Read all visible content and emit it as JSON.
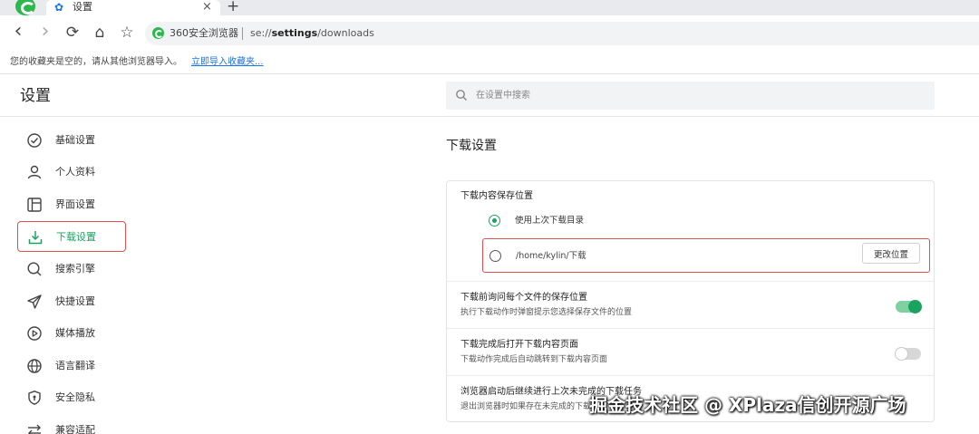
{
  "tab": {
    "title": "设置",
    "close": "×",
    "new_tab": "+"
  },
  "toolbar": {
    "back": "‹",
    "forward": "›",
    "reload": "⟳",
    "home": "⌂",
    "star": "☆",
    "site_label": "360安全浏览器",
    "url_scheme": "se://",
    "url_host": "settings",
    "url_path": "/downloads"
  },
  "bookmarks_bar": {
    "message": "您的收藏夹是空的，请从其他浏览器导入。",
    "import_link": "立即导入收藏夹..."
  },
  "header": {
    "title": "设置",
    "search_placeholder": "在设置中搜索"
  },
  "sidebar": {
    "items": [
      {
        "label": "基础设置",
        "icon": "check-circle-icon"
      },
      {
        "label": "个人资料",
        "icon": "person-icon"
      },
      {
        "label": "界面设置",
        "icon": "layout-icon"
      },
      {
        "label": "下载设置",
        "icon": "download-icon",
        "active": true
      },
      {
        "label": "搜索引擎",
        "icon": "search-icon"
      },
      {
        "label": "快捷设置",
        "icon": "send-icon"
      },
      {
        "label": "媒体播放",
        "icon": "play-circle-icon"
      },
      {
        "label": "语言翻译",
        "icon": "globe-icon"
      },
      {
        "label": "安全隐私",
        "icon": "shield-icon"
      },
      {
        "label": "兼容适配",
        "icon": "arrows-icon"
      }
    ]
  },
  "main": {
    "section_title": "下载设置",
    "save_location": {
      "title": "下载内容保存位置",
      "option_last": "使用上次下载目录",
      "option_path": "/home/kylin/下载",
      "change_button": "更改位置",
      "selected": "last"
    },
    "options": [
      {
        "title": "下载前询问每个文件的保存位置",
        "desc": "执行下载动作时弹窗提示您选择保存文件的位置",
        "enabled": true
      },
      {
        "title": "下载完成后打开下载内容页面",
        "desc": "下载动作完成后自动跳转到下载内容页面",
        "enabled": false
      },
      {
        "title": "浏览器启动后继续进行上次未完成的下载任务",
        "desc": "退出浏览器时如果存在未完成的下载任务"
      }
    ]
  },
  "colors": {
    "accent": "#1aa260",
    "highlight_border": "#e05050",
    "link": "#1a73e8"
  },
  "watermark": "掘金技术社区 @ XPlaza信创开源广场"
}
